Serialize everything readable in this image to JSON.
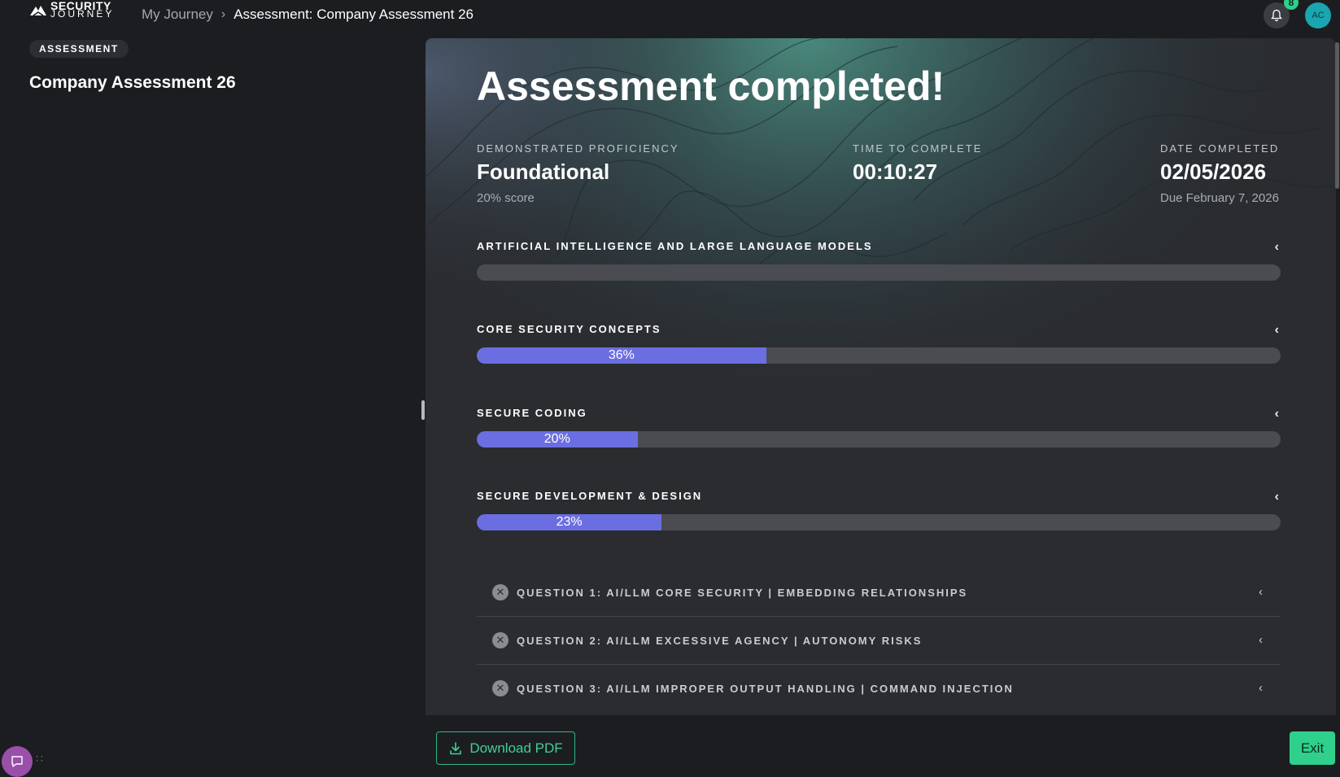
{
  "header": {
    "logo_line1": "SECURITY",
    "logo_line2": "JOURNEY",
    "breadcrumb_root": "My Journey",
    "breadcrumb_current": "Assessment: Company Assessment 26",
    "notification_count": "8",
    "avatar_initials": "AC"
  },
  "sidebar": {
    "tag": "ASSESSMENT",
    "title": "Company Assessment 26"
  },
  "main": {
    "hero": "Assessment completed!",
    "stats": [
      {
        "label": "DEMONSTRATED PROFICIENCY",
        "value": "Foundational",
        "sub": "20% score"
      },
      {
        "label": "TIME TO COMPLETE",
        "value": "00:10:27",
        "sub": ""
      },
      {
        "label": "DATE COMPLETED",
        "value": "02/05/2026",
        "sub": "Due February 7, 2026"
      }
    ],
    "topics": [
      {
        "label": "ARTIFICIAL INTELLIGENCE AND LARGE LANGUAGE MODELS",
        "percent_text": "",
        "percent": 0
      },
      {
        "label": "CORE SECURITY CONCEPTS",
        "percent_text": "36%",
        "percent": 36
      },
      {
        "label": "SECURE CODING",
        "percent_text": "20%",
        "percent": 20
      },
      {
        "label": "SECURE DEVELOPMENT & DESIGN",
        "percent_text": "23%",
        "percent": 23
      }
    ],
    "questions": [
      {
        "label": "QUESTION 1: AI/LLM CORE SECURITY | EMBEDDING RELATIONSHIPS"
      },
      {
        "label": "QUESTION 2: AI/LLM EXCESSIVE AGENCY | AUTONOMY RISKS"
      },
      {
        "label": "QUESTION 3: AI/LLM IMPROPER OUTPUT HANDLING | COMMAND INJECTION"
      }
    ]
  },
  "footer": {
    "download_label": "Download PDF",
    "exit_label": "Exit"
  },
  "colors": {
    "accent_green": "#2fd08c",
    "progress_fill": "#6b6ee0",
    "background": "#1c1d21"
  },
  "icons": [
    "mountain-logo-icon",
    "chevron-right-icon",
    "bell-icon",
    "chevron-left-icon",
    "x-circle-icon",
    "download-icon",
    "chat-icon",
    "drag-handle-icon"
  ]
}
